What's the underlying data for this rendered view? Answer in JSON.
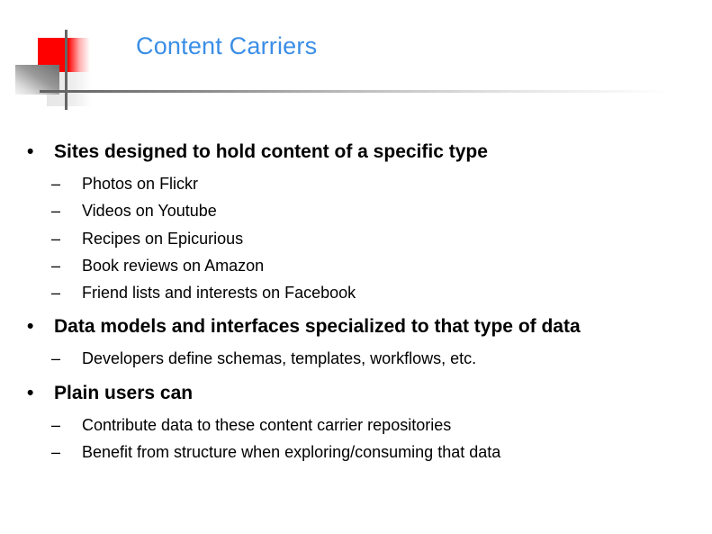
{
  "slide": {
    "title": "Content Carriers",
    "logo": {
      "icon": "decorative-squares-logo",
      "accent_color": "#ff0000"
    },
    "title_color": "#3a8ee6",
    "bullet_glyph": "•",
    "dash_glyph": "–",
    "bullets": [
      {
        "text": "Sites designed to hold content of a specific type",
        "sub": [
          "Photos on Flickr",
          "Videos on Youtube",
          "Recipes on Epicurious",
          "Book reviews on Amazon",
          "Friend lists and interests on Facebook"
        ]
      },
      {
        "text": "Data models and interfaces specialized to that type of data",
        "sub": [
          "Developers define schemas, templates, workflows, etc."
        ]
      },
      {
        "text": "Plain users can",
        "sub": [
          "Contribute data to these content carrier repositories",
          "Benefit from structure when exploring/consuming that data"
        ]
      }
    ]
  }
}
